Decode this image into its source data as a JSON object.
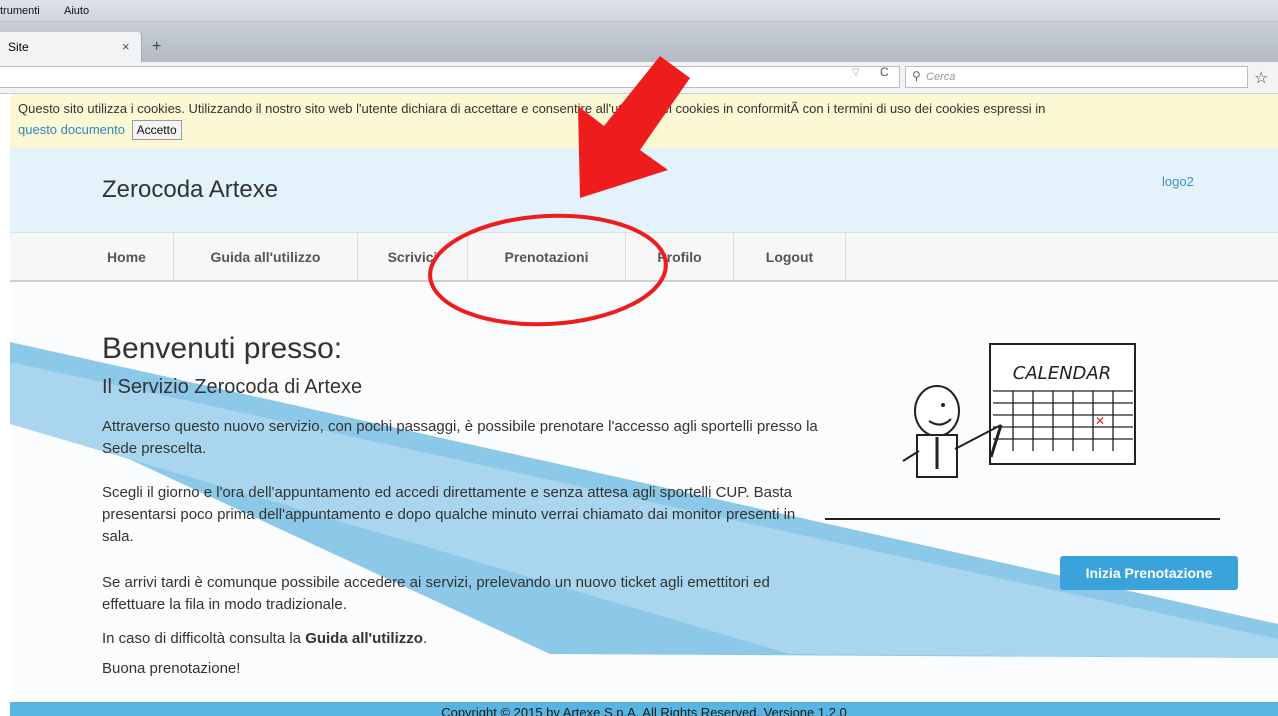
{
  "browser": {
    "menu": [
      "trumenti",
      "Aiuto"
    ],
    "tab_title": "Site",
    "tab_close": "×",
    "new_tab": "+",
    "search_placeholder": "Cerca"
  },
  "cookie_bar": {
    "text": "Questo sito utilizza i cookies. Utilizzando il nostro sito web l'utente dichiara di accettare e consentire all'utilizzo dei cookies in conformitÃ  con i termini di uso dei cookies espressi in",
    "link": "questo documento",
    "accept_label": "Accetto"
  },
  "header": {
    "brand": "Zerocoda Artexe",
    "logo_text": "logo2"
  },
  "nav": {
    "items": [
      {
        "label": "Home"
      },
      {
        "label": "Guida all'utilizzo"
      },
      {
        "label": "Scrivici"
      },
      {
        "label": "Prenotazioni"
      },
      {
        "label": "Profilo"
      },
      {
        "label": "Logout"
      }
    ]
  },
  "main": {
    "heading": "Benvenuti presso:",
    "subheading": "Il Servizio Zerocoda di Artexe",
    "p1": "Attraverso questo nuovo servizio, con pochi passaggi, è possibile prenotare l'accesso agli sportelli presso la Sede prescelta.",
    "p2": "Scegli il giorno e l'ora dell'appuntamento ed accedi direttamente e senza attesa agli sportelli CUP. Basta presentarsi poco prima dell'appuntamento e dopo qualche minuto verrai chiamato dai monitor presenti in sala.",
    "p3": "Se arrivi tardi è comunque possibile accedere ai servizi, prelevando un nuovo ticket agli emettitori ed effettuare la fila in modo tradizionale.",
    "p4_prefix": "In caso di difficoltà consulta la ",
    "p4_link": "Guida all'utilizzo",
    "p4_suffix": ".",
    "p5": "Buona prenotazione!",
    "calendar_title": "CALENDAR",
    "cta_label": "Inizia Prenotazione"
  },
  "footer": {
    "text": "Copyright © 2015 by Artexe S.p.A. All Rights Reserved. Versione 1.2.0"
  },
  "colors": {
    "accent": "#3aa3dc",
    "annotation": "#ee1c1c"
  }
}
